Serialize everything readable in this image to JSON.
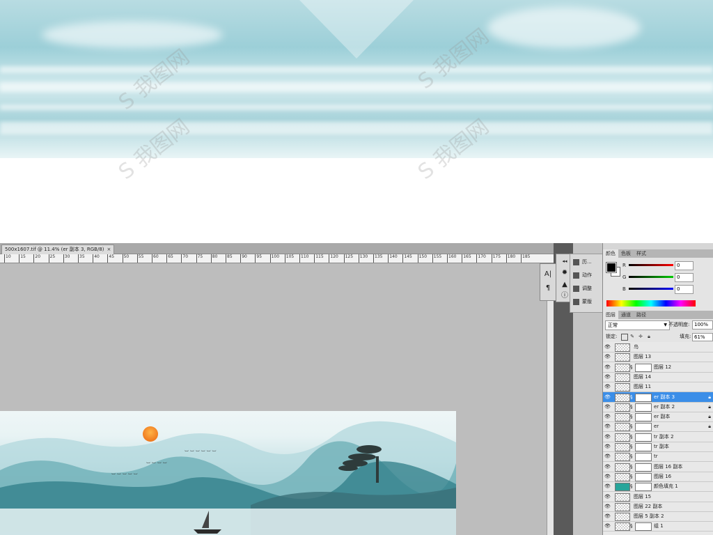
{
  "document": {
    "tab_title": "500x1607.tif @ 11.4% (er 副本 3, RGB/8)",
    "close_glyph": "×",
    "ruler_ticks": [
      "10",
      "15",
      "20",
      "25",
      "30",
      "35",
      "40",
      "45",
      "50",
      "55",
      "60",
      "65",
      "70",
      "75",
      "80",
      "85",
      "90",
      "95",
      "100",
      "105",
      "110",
      "115",
      "120",
      "125",
      "130",
      "135",
      "140",
      "145",
      "150",
      "155",
      "160",
      "165",
      "170",
      "175",
      "180",
      "185"
    ]
  },
  "dock": {
    "collapse_glyph": "◂◂",
    "panels": [
      {
        "label": "历...",
        "icon": "history-icon"
      },
      {
        "label": "动作",
        "icon": "actions-icon"
      },
      {
        "label": "调整",
        "icon": "adjustments-icon"
      },
      {
        "label": "蒙版",
        "icon": "masks-icon"
      }
    ],
    "tools": [
      {
        "glyph": "A|",
        "icon": "character-icon"
      },
      {
        "glyph": "¶",
        "icon": "paragraph-icon"
      }
    ]
  },
  "color_panel": {
    "tabs": [
      "颜色",
      "色板",
      "样式"
    ],
    "channels": [
      {
        "label": "R",
        "value": "0",
        "color": "#d92020"
      },
      {
        "label": "G",
        "value": "0",
        "color": "#1fa01f"
      },
      {
        "label": "B",
        "value": "0",
        "color": "#2020d0"
      }
    ],
    "foreground": "#000000",
    "background": "#ffffff"
  },
  "layers_panel": {
    "tabs": [
      "图层",
      "通道",
      "路径"
    ],
    "blend_mode": "正常",
    "opacity_label": "不透明度:",
    "opacity_value": "100%",
    "lock_label": "锁定:",
    "fill_label": "填充:",
    "fill_value": "61%",
    "layers": [
      {
        "name": "鸟",
        "mask": false,
        "selected": false,
        "locked": false,
        "fill": false
      },
      {
        "name": "图层 13",
        "mask": false,
        "selected": false,
        "locked": false,
        "fill": false
      },
      {
        "name": "图层 12",
        "mask": true,
        "selected": false,
        "locked": false,
        "fill": false
      },
      {
        "name": "图层 14",
        "mask": false,
        "selected": false,
        "locked": false,
        "fill": false
      },
      {
        "name": "图层 11",
        "mask": false,
        "selected": false,
        "locked": false,
        "fill": false
      },
      {
        "name": "er 副本 3",
        "mask": true,
        "selected": true,
        "locked": true,
        "fill": false
      },
      {
        "name": "er 副本 2",
        "mask": true,
        "selected": false,
        "locked": true,
        "fill": false
      },
      {
        "name": "er 副本",
        "mask": true,
        "selected": false,
        "locked": true,
        "fill": false
      },
      {
        "name": "er",
        "mask": true,
        "selected": false,
        "locked": true,
        "fill": false
      },
      {
        "name": "tr 副本 2",
        "mask": true,
        "selected": false,
        "locked": false,
        "fill": false
      },
      {
        "name": "tr 副本",
        "mask": true,
        "selected": false,
        "locked": false,
        "fill": false
      },
      {
        "name": "tr",
        "mask": true,
        "selected": false,
        "locked": false,
        "fill": false
      },
      {
        "name": "图层 16 副本",
        "mask": true,
        "selected": false,
        "locked": false,
        "fill": false
      },
      {
        "name": "图层 16",
        "mask": true,
        "selected": false,
        "locked": false,
        "fill": false
      },
      {
        "name": "颜色填充 1",
        "mask": true,
        "selected": false,
        "locked": false,
        "fill": true
      },
      {
        "name": "图层 15",
        "mask": false,
        "selected": false,
        "locked": false,
        "fill": false
      },
      {
        "name": "图层 22 副本",
        "mask": false,
        "selected": false,
        "locked": false,
        "fill": false
      },
      {
        "name": "图层 5 副本 2",
        "mask": false,
        "selected": false,
        "locked": false,
        "fill": false
      },
      {
        "name": "组 1",
        "mask": true,
        "selected": false,
        "locked": false,
        "fill": false
      }
    ]
  }
}
